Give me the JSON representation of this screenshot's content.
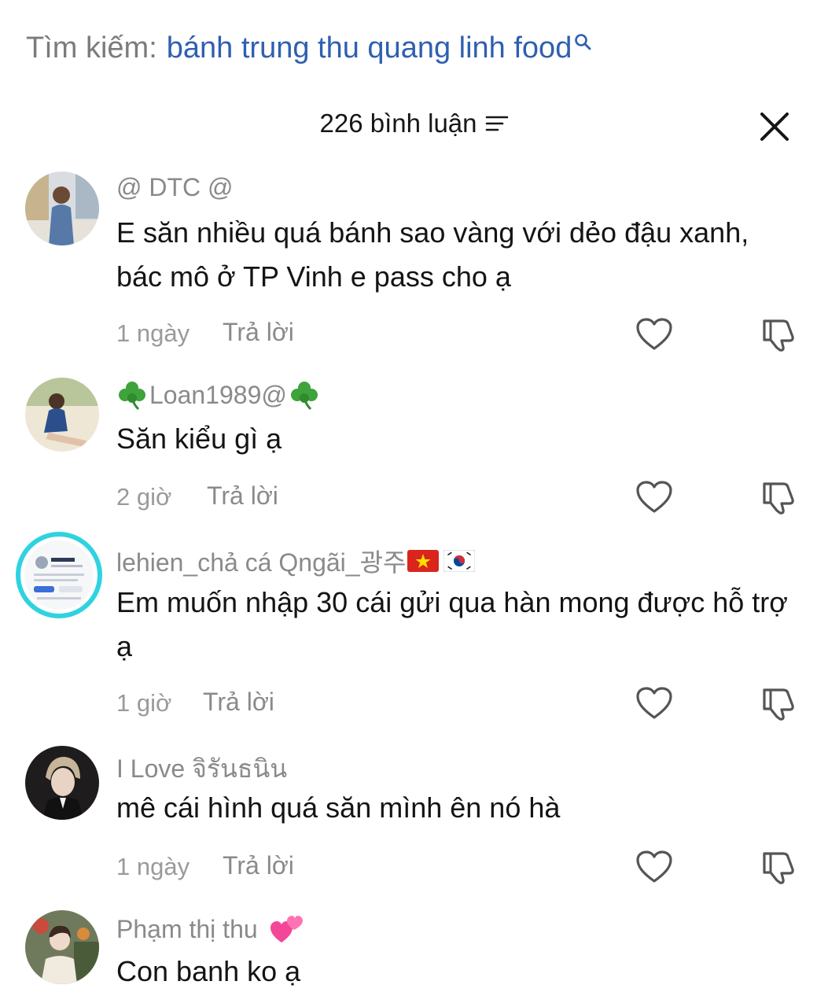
{
  "search": {
    "prefix": "Tìm kiếm:",
    "query": "bánh trung thu quang linh food"
  },
  "header": {
    "comment_count": "226 bình luận"
  },
  "comments": [
    {
      "username": "@ DTC @",
      "text": "E săn nhiều quá bánh sao vàng với dẻo đậu xanh, bác mô ở TP Vinh e pass cho ạ",
      "time": "1 ngày",
      "reply_label": "Trả lời"
    },
    {
      "username": "Loan1989@",
      "text": "Săn kiểu gì ạ",
      "time": "2 giờ",
      "reply_label": "Trả lời"
    },
    {
      "username": "lehien_chả cá Qngãi_광주",
      "text": "Em muốn nhập 30 cái gửi qua hàn mong được hỗ trợ ạ",
      "time": "1 giờ",
      "reply_label": "Trả lời"
    },
    {
      "username": "I Love จิรันธนิน",
      "text": "mê cái hình quá săn mình ên nó hà",
      "time": "1 ngày",
      "reply_label": "Trả lời"
    },
    {
      "username": "Phạm thị thu",
      "text": "Con banh ko ạ"
    }
  ],
  "colors": {
    "query": "#2f5fb0",
    "muted": "#8a8a8a",
    "text": "#141414",
    "avatar_ring": "#2fd3e0"
  },
  "icons": [
    "search-icon",
    "sort-icon",
    "close-icon",
    "heart-icon",
    "dislike-icon",
    "clover-icon",
    "vietnam-flag-icon",
    "korea-flag-icon",
    "two-hearts-icon"
  ]
}
